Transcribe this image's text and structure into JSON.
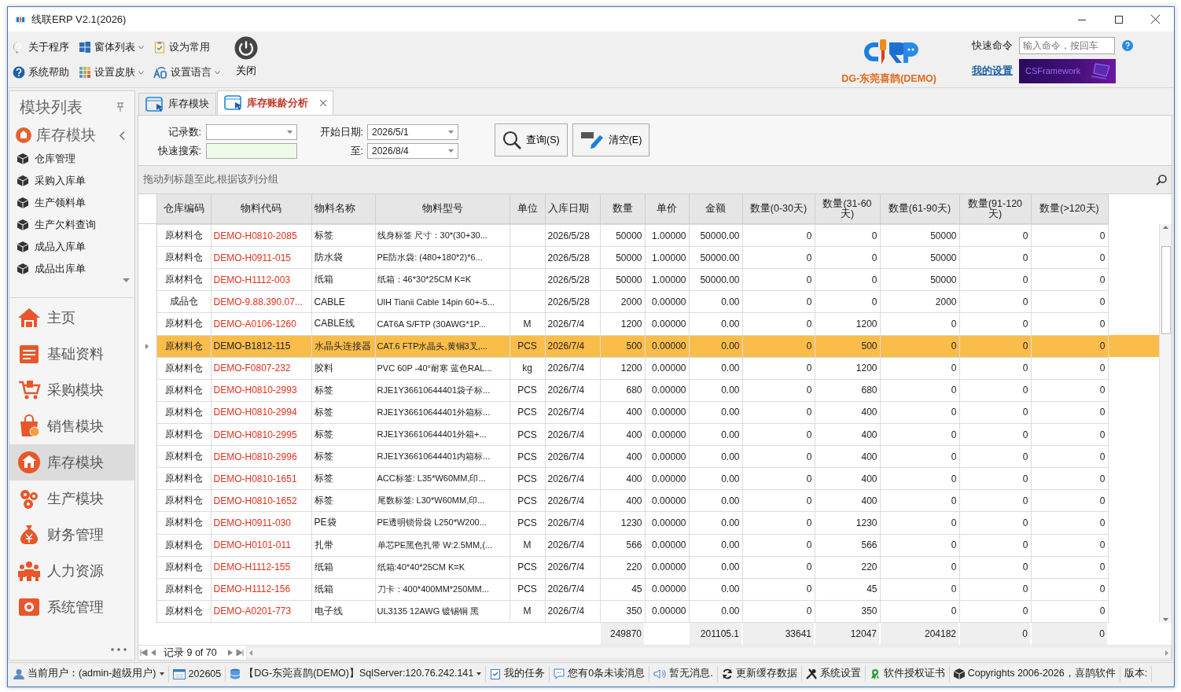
{
  "window": {
    "title": "线联ERP V2.1(2026)"
  },
  "toolbar": {
    "items": [
      {
        "label": "关于程序",
        "dropdown": false
      },
      {
        "label": "窗体列表",
        "dropdown": true
      },
      {
        "label": "设为常用",
        "dropdown": false
      },
      {
        "label": "系统帮助",
        "dropdown": false
      },
      {
        "label": "设置皮肤",
        "dropdown": true
      },
      {
        "label": "设置语言",
        "dropdown": true
      }
    ],
    "close_button": {
      "label": "关闭"
    }
  },
  "brand": {
    "company": "DG-东莞喜鹊(DEMO)",
    "banner": "CSFramework"
  },
  "quick_command": {
    "label": "快速命令",
    "placeholder": "输入命令，按回车"
  },
  "settings_link": "我的设置",
  "sidebar": {
    "title": "模块列表",
    "module": "库存模块",
    "sub_items": [
      "仓库管理",
      "采购入库单",
      "生产领料单",
      "生产欠料查询",
      "成品入库单",
      "成品出库单"
    ],
    "nav_items": [
      {
        "label": "主页",
        "selected": false
      },
      {
        "label": "基础资料",
        "selected": false
      },
      {
        "label": "采购模块",
        "selected": false
      },
      {
        "label": "销售模块",
        "selected": false
      },
      {
        "label": "库存模块",
        "selected": true
      },
      {
        "label": "生产模块",
        "selected": false
      },
      {
        "label": "财务管理",
        "selected": false
      },
      {
        "label": "人力资源",
        "selected": false
      },
      {
        "label": "系统管理",
        "selected": false
      }
    ]
  },
  "tabs": [
    {
      "label": "库存模块",
      "selected": false,
      "closable": false
    },
    {
      "label": "库存账龄分析",
      "selected": true,
      "closable": true
    }
  ],
  "filter": {
    "record_count": {
      "label": "记录数:"
    },
    "quick_search": {
      "label": "快速搜索:"
    },
    "start_date": {
      "label": "开始日期:",
      "value": "2026/5/1"
    },
    "end_date": {
      "label": "至:",
      "value": "2026/8/4"
    },
    "buttons": [
      "查询(S)",
      "清空(E)"
    ]
  },
  "grid": {
    "group_panel": "拖动列标题至此,根据该列分组",
    "columns": [
      "仓库编码",
      "物料代码",
      "物料名称",
      "物料型号",
      "单位",
      "入库日期",
      "数量",
      "单价",
      "金额",
      "数量(0-30天)",
      "数量(31-60天)",
      "数量(61-90天)",
      "数量(91-120天)",
      "数量(>120天)"
    ],
    "rows": [
      {
        "selected": false,
        "warehouse": "原材料仓",
        "material_code": "DEMO-H0810-2085",
        "material_name": "标签",
        "model": "线身标签 尺寸：30*(30+30...",
        "inbound_date": "2026/5/28",
        "quantity": "50000",
        "unit_price": "1.00000",
        "amount": "50000.00",
        "qty_0_30": "0",
        "qty_31_60": "0",
        "qty_61_90": "50000",
        "qty_91_120": "0",
        "qty_over_120": "0"
      },
      {
        "selected": false,
        "warehouse": "原材料仓",
        "material_code": "DEMO-H0911-015",
        "material_name": "防水袋",
        "model": "PE防水袋: (480+180*2)*6...",
        "inbound_date": "2026/5/28",
        "quantity": "50000",
        "unit_price": "1.00000",
        "amount": "50000.00",
        "qty_0_30": "0",
        "qty_31_60": "0",
        "qty_61_90": "50000",
        "qty_91_120": "0",
        "qty_over_120": "0"
      },
      {
        "selected": false,
        "warehouse": "原材料仓",
        "material_code": "DEMO-H1112-003",
        "material_name": "纸箱",
        "model": "纸箱：46*30*25CM K=K",
        "inbound_date": "2026/5/28",
        "quantity": "50000",
        "unit_price": "1.00000",
        "amount": "50000.00",
        "qty_0_30": "0",
        "qty_31_60": "0",
        "qty_61_90": "50000",
        "qty_91_120": "0",
        "qty_over_120": "0"
      },
      {
        "selected": false,
        "warehouse": "成品仓",
        "material_code": "DEMO-9.88.390.07...",
        "material_name": "CABLE",
        "model": "UlH Tianii Cable 14pin 60+-5...",
        "inbound_date": "2026/5/28",
        "quantity": "2000",
        "unit_price": "0.00000",
        "amount": "0.00",
        "qty_0_30": "0",
        "qty_31_60": "0",
        "qty_61_90": "2000",
        "qty_91_120": "0",
        "qty_over_120": "0"
      },
      {
        "selected": false,
        "warehouse": "原材料仓",
        "material_code": "DEMO-A0106-1260",
        "material_name": "CABLE线",
        "model": "CAT6A S/FTP (30AWG*1P...",
        "unit": "M",
        "inbound_date": "2026/7/4",
        "quantity": "1200",
        "unit_price": "0.00000",
        "amount": "0.00",
        "qty_0_30": "0",
        "qty_31_60": "1200",
        "qty_61_90": "0",
        "qty_91_120": "0",
        "qty_over_120": "0"
      },
      {
        "selected": true,
        "warehouse": "原材料仓",
        "material_code": "DEMO-B1812-115",
        "material_name": "水晶头连接器",
        "model": "CAT.6 FTP水晶头,黄铜3叉,...",
        "unit": "PCS",
        "inbound_date": "2026/7/4",
        "quantity": "500",
        "unit_price": "0.00000",
        "amount": "0.00",
        "qty_0_30": "0",
        "qty_31_60": "500",
        "qty_61_90": "0",
        "qty_91_120": "0",
        "qty_over_120": "0"
      },
      {
        "selected": false,
        "warehouse": "原材料仓",
        "material_code": "DEMO-F0807-232",
        "material_name": "胶料",
        "model": "PVC 60P -40°耐寒 蓝色RAL...",
        "unit": "kg",
        "inbound_date": "2026/7/4",
        "quantity": "1200",
        "unit_price": "0.00000",
        "amount": "0.00",
        "qty_0_30": "0",
        "qty_31_60": "1200",
        "qty_61_90": "0",
        "qty_91_120": "0",
        "qty_over_120": "0"
      },
      {
        "selected": false,
        "warehouse": "原材料仓",
        "material_code": "DEMO-H0810-2993",
        "material_name": "标签",
        "model": "RJE1Y36610644401袋子标...",
        "unit": "PCS",
        "inbound_date": "2026/7/4",
        "quantity": "680",
        "unit_price": "0.00000",
        "amount": "0.00",
        "qty_0_30": "0",
        "qty_31_60": "680",
        "qty_61_90": "0",
        "qty_91_120": "0",
        "qty_over_120": "0"
      },
      {
        "selected": false,
        "warehouse": "原材料仓",
        "material_code": "DEMO-H0810-2994",
        "material_name": "标签",
        "model": "RJE1Y36610644401外箱标...",
        "unit": "PCS",
        "inbound_date": "2026/7/4",
        "quantity": "400",
        "unit_price": "0.00000",
        "amount": "0.00",
        "qty_0_30": "0",
        "qty_31_60": "400",
        "qty_61_90": "0",
        "qty_91_120": "0",
        "qty_over_120": "0"
      },
      {
        "selected": false,
        "warehouse": "原材料仓",
        "material_code": "DEMO-H0810-2995",
        "material_name": "标签",
        "model": "RJE1Y36610644401外箱+...",
        "unit": "PCS",
        "inbound_date": "2026/7/4",
        "quantity": "400",
        "unit_price": "0.00000",
        "amount": "0.00",
        "qty_0_30": "0",
        "qty_31_60": "400",
        "qty_61_90": "0",
        "qty_91_120": "0",
        "qty_over_120": "0"
      },
      {
        "selected": false,
        "warehouse": "原材料仓",
        "material_code": "DEMO-H0810-2996",
        "material_name": "标签",
        "model": "RJE1Y36610644401内箱标...",
        "unit": "PCS",
        "inbound_date": "2026/7/4",
        "quantity": "400",
        "unit_price": "0.00000",
        "amount": "0.00",
        "qty_0_30": "0",
        "qty_31_60": "400",
        "qty_61_90": "0",
        "qty_91_120": "0",
        "qty_over_120": "0"
      },
      {
        "selected": false,
        "warehouse": "原材料仓",
        "material_code": "DEMO-H0810-1651",
        "material_name": "标签",
        "model": "ACC标签: L35*W60MM,印...",
        "unit": "PCS",
        "inbound_date": "2026/7/4",
        "quantity": "400",
        "unit_price": "0.00000",
        "amount": "0.00",
        "qty_0_30": "0",
        "qty_31_60": "400",
        "qty_61_90": "0",
        "qty_91_120": "0",
        "qty_over_120": "0"
      },
      {
        "selected": false,
        "warehouse": "原材料仓",
        "material_code": "DEMO-H0810-1652",
        "material_name": "标签",
        "model": "尾数标签: L30*W60MM,印...",
        "unit": "PCS",
        "inbound_date": "2026/7/4",
        "quantity": "400",
        "unit_price": "0.00000",
        "amount": "0.00",
        "qty_0_30": "0",
        "qty_31_60": "400",
        "qty_61_90": "0",
        "qty_91_120": "0",
        "qty_over_120": "0"
      },
      {
        "selected": false,
        "warehouse": "原材料仓",
        "material_code": "DEMO-H0911-030",
        "material_name": "PE袋",
        "model": "PE透明锁骨袋 L250*W200...",
        "unit": "PCS",
        "inbound_date": "2026/7/4",
        "quantity": "1230",
        "unit_price": "0.00000",
        "amount": "0.00",
        "qty_0_30": "0",
        "qty_31_60": "1230",
        "qty_61_90": "0",
        "qty_91_120": "0",
        "qty_over_120": "0"
      },
      {
        "selected": false,
        "warehouse": "原材料仓",
        "material_code": "DEMO-H0101-011",
        "material_name": "扎带",
        "model": "单芯PE黑色扎带 W:2.5MM,(...",
        "unit": "M",
        "inbound_date": "2026/7/4",
        "quantity": "566",
        "unit_price": "0.00000",
        "amount": "0.00",
        "qty_0_30": "0",
        "qty_31_60": "566",
        "qty_61_90": "0",
        "qty_91_120": "0",
        "qty_over_120": "0"
      },
      {
        "selected": false,
        "warehouse": "原材料仓",
        "material_code": "DEMO-H1112-155",
        "material_name": "纸箱",
        "model": "纸箱:40*40*25CM K=K",
        "unit": "PCS",
        "inbound_date": "2026/7/4",
        "quantity": "220",
        "unit_price": "0.00000",
        "amount": "0.00",
        "qty_0_30": "0",
        "qty_31_60": "220",
        "qty_61_90": "0",
        "qty_91_120": "0",
        "qty_over_120": "0"
      },
      {
        "selected": false,
        "warehouse": "原材料仓",
        "material_code": "DEMO-H1112-156",
        "material_name": "纸箱",
        "model": "刀卡：400*400MM*250MM...",
        "unit": "PCS",
        "inbound_date": "2026/7/4",
        "quantity": "45",
        "unit_price": "0.00000",
        "amount": "0.00",
        "qty_0_30": "0",
        "qty_31_60": "45",
        "qty_61_90": "0",
        "qty_91_120": "0",
        "qty_over_120": "0"
      },
      {
        "selected": false,
        "warehouse": "原材料仓",
        "material_code": "DEMO-A0201-773",
        "material_name": "电子线",
        "model": "UL3135 12AWG 镀锡铜 黑",
        "unit": "M",
        "inbound_date": "2026/7/4",
        "quantity": "350",
        "unit_price": "0.00000",
        "amount": "0.00",
        "qty_0_30": "0",
        "qty_31_60": "350",
        "qty_61_90": "0",
        "qty_91_120": "0",
        "qty_over_120": "0"
      }
    ],
    "totals": {
      "quantity": "249870",
      "amount": "201105.1",
      "qty_0_30": "33641",
      "qty_31_60": "12047",
      "qty_61_90": "204182",
      "qty_91_120": "0",
      "qty_over_120": "0"
    },
    "navigator": "记录 9 of 70"
  },
  "status_bar": [
    {
      "text": "当前用户：(admin-超级用户)",
      "dropdown": true
    },
    {
      "text": "202605",
      "dropdown": false
    },
    {
      "text": "【DG-东莞喜鹊(DEMO)】SqlServer:120.76.242.141",
      "dropdown": true
    },
    {
      "text": "我的任务",
      "dropdown": false
    },
    {
      "text": "您有0条未读消息",
      "dropdown": false
    },
    {
      "text": "暂无消息.",
      "dropdown": false
    },
    {
      "text": "更新缓存数据",
      "dropdown": false
    },
    {
      "text": "系统设置",
      "dropdown": false
    },
    {
      "text": "软件授权证书",
      "dropdown": false
    },
    {
      "text": "Copyrights 2006-2026，喜鹊软件",
      "dropdown": false
    },
    {
      "text": "版本:",
      "dropdown": false
    }
  ]
}
